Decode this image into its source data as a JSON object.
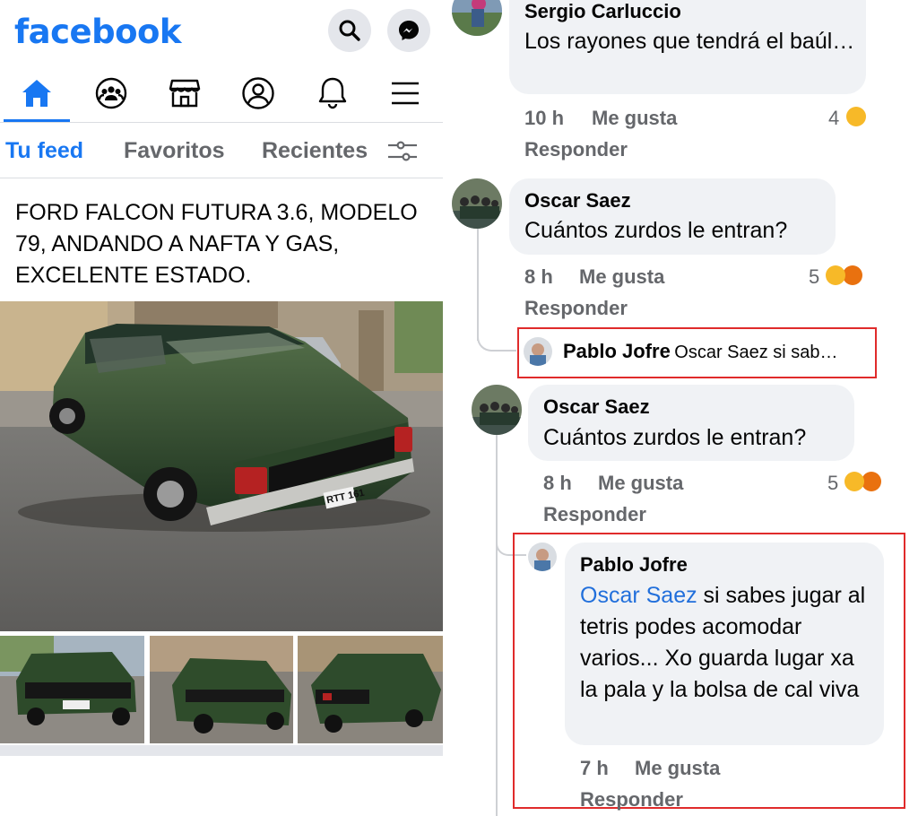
{
  "app": {
    "logo": "facebook",
    "brand_color": "#1877f2"
  },
  "header": {
    "search_icon": "search-icon",
    "messenger_icon": "messenger-icon"
  },
  "nav": {
    "items": [
      "home-icon",
      "groups-icon",
      "marketplace-icon",
      "profile-icon",
      "notifications-icon",
      "menu-icon"
    ],
    "active": "home-icon"
  },
  "feed_tabs": {
    "items": [
      "Tu feed",
      "Favoritos",
      "Recientes"
    ],
    "active": "Tu feed",
    "filter_icon": "sliders-icon"
  },
  "post": {
    "text": "FORD FALCON FUTURA 3.6, MODELO 79, ANDANDO A NAFTA Y GAS, EXCELENTE ESTADO.",
    "main_photo_plate": "RTT 161"
  },
  "comments": [
    {
      "author": "Sergio Carluccio",
      "text": "Los rayones que tendrá el baúl…",
      "time": "10 h",
      "like": "Me gusta",
      "reply": "Responder",
      "reactions_count": "4",
      "reactions": [
        "laugh"
      ]
    },
    {
      "author": "Oscar Saez",
      "text": "Cuántos zurdos le entran?",
      "time": "8 h",
      "like": "Me gusta",
      "reply": "Responder",
      "reactions_count": "5",
      "reactions": [
        "laugh",
        "angry"
      ],
      "collapsed_reply": {
        "author": "Pablo Jofre",
        "preview": "Oscar Saez si sab…"
      }
    },
    {
      "author": "Oscar Saez",
      "text": "Cuántos zurdos le entran?",
      "time": "8 h",
      "like": "Me gusta",
      "reply": "Responder",
      "reactions_count": "5",
      "reactions": [
        "laugh",
        "angry"
      ]
    },
    {
      "author": "Pablo Jofre",
      "mention": "Oscar Saez",
      "text": " si sabes jugar al tetris podes acomodar varios... Xo guarda lugar xa la pala y la bolsa de cal viva",
      "time": "7 h",
      "like": "Me gusta",
      "reply": "Responder"
    }
  ],
  "colors": {
    "highlight_box": "#e02b2b",
    "mention": "#216fdb",
    "bubble": "#f0f2f5",
    "meta_text": "#65676b"
  }
}
